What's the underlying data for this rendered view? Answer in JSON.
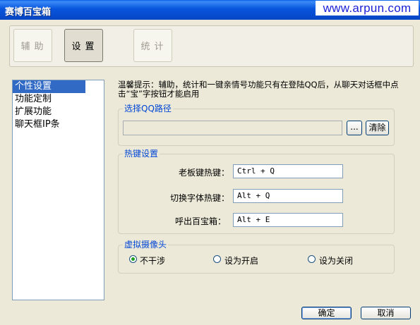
{
  "window": {
    "title": "赛博百宝箱",
    "watermark": "www.arpun.com"
  },
  "toolbar": {
    "tabs": [
      {
        "label": "辅助"
      },
      {
        "label": "设置"
      },
      {
        "label": "统计"
      }
    ]
  },
  "nav": {
    "items": [
      {
        "label": "个性设置"
      },
      {
        "label": "功能定制"
      },
      {
        "label": "扩展功能"
      },
      {
        "label": "聊天框IP条"
      }
    ]
  },
  "hint": "温馨提示：辅助，统计和一键亲情号功能只有在登陆QQ后，从聊天对话框中点击“宝”字按钮才能启用",
  "qq_path": {
    "title": "选择QQ路径",
    "value": "",
    "browse": "...",
    "clear": "清除"
  },
  "hotkeys": {
    "title": "热键设置",
    "boss_label": "老板键热键：",
    "boss_value": "Ctrl + Q",
    "font_label": "切换字体热键：",
    "font_value": "Alt + Q",
    "show_label": "呼出百宝箱：",
    "show_value": "Alt + E"
  },
  "camera": {
    "title": "虚拟摄像头",
    "opt1": "不干涉",
    "opt2": "设为开启",
    "opt3": "设为关闭",
    "selected": "不干涉"
  },
  "buttons": {
    "ok": "确定",
    "cancel": "取消"
  }
}
